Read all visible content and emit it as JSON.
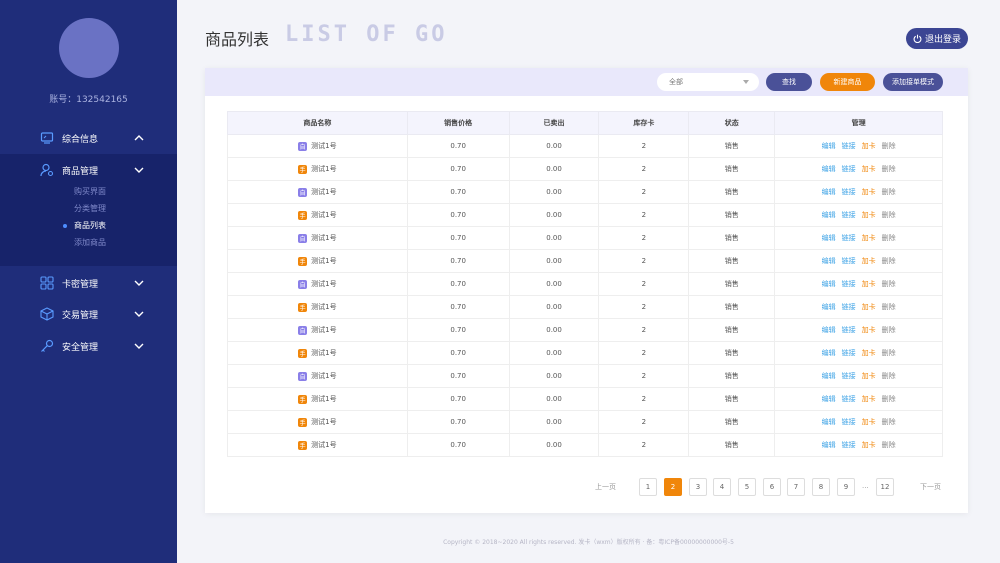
{
  "sidebar": {
    "account": "账号：132542165",
    "nav": [
      {
        "label": "综合信息",
        "icon": "dashboard-icon",
        "chevron": "up"
      },
      {
        "label": "商品管理",
        "icon": "user-icon",
        "chevron": "down"
      },
      {
        "label": "卡密管理",
        "icon": "grid-icon",
        "chevron": "down"
      },
      {
        "label": "交易管理",
        "icon": "box-icon",
        "chevron": "down"
      },
      {
        "label": "安全管理",
        "icon": "key-icon",
        "chevron": "down"
      }
    ],
    "sub": [
      "购买界面",
      "分类管理",
      "商品列表",
      "添加商品"
    ],
    "active_sub": "商品列表"
  },
  "header": {
    "title": "商品列表",
    "title_en": "LIST OF GO",
    "logout": "退出登录"
  },
  "toolbar": {
    "select_value": "全部",
    "search": "查找",
    "new": "新建商品",
    "batch": "添加接单模式"
  },
  "table": {
    "columns": [
      "商品名称",
      "销售价格",
      "已卖出",
      "库存卡",
      "状态",
      "管理"
    ],
    "actions": [
      "编辑",
      "链接",
      "加卡",
      "删除"
    ],
    "rows": [
      {
        "badge": "自",
        "type": "auto",
        "name": "测试1号",
        "price": "0.70",
        "sold": "0.00",
        "stock": "2",
        "status": "销售"
      },
      {
        "badge": "手",
        "type": "manual",
        "name": "测试1号",
        "price": "0.70",
        "sold": "0.00",
        "stock": "2",
        "status": "销售"
      },
      {
        "badge": "自",
        "type": "auto",
        "name": "测试1号",
        "price": "0.70",
        "sold": "0.00",
        "stock": "2",
        "status": "销售"
      },
      {
        "badge": "手",
        "type": "manual",
        "name": "测试1号",
        "price": "0.70",
        "sold": "0.00",
        "stock": "2",
        "status": "销售"
      },
      {
        "badge": "自",
        "type": "auto",
        "name": "测试1号",
        "price": "0.70",
        "sold": "0.00",
        "stock": "2",
        "status": "销售"
      },
      {
        "badge": "手",
        "type": "manual",
        "name": "测试1号",
        "price": "0.70",
        "sold": "0.00",
        "stock": "2",
        "status": "销售"
      },
      {
        "badge": "自",
        "type": "auto",
        "name": "测试1号",
        "price": "0.70",
        "sold": "0.00",
        "stock": "2",
        "status": "销售"
      },
      {
        "badge": "手",
        "type": "manual",
        "name": "测试1号",
        "price": "0.70",
        "sold": "0.00",
        "stock": "2",
        "status": "销售"
      },
      {
        "badge": "自",
        "type": "auto",
        "name": "测试1号",
        "price": "0.70",
        "sold": "0.00",
        "stock": "2",
        "status": "销售"
      },
      {
        "badge": "手",
        "type": "manual",
        "name": "测试1号",
        "price": "0.70",
        "sold": "0.00",
        "stock": "2",
        "status": "销售"
      },
      {
        "badge": "自",
        "type": "auto",
        "name": "测试1号",
        "price": "0.70",
        "sold": "0.00",
        "stock": "2",
        "status": "销售"
      },
      {
        "badge": "手",
        "type": "manual",
        "name": "测试1号",
        "price": "0.70",
        "sold": "0.00",
        "stock": "2",
        "status": "销售"
      },
      {
        "badge": "手",
        "type": "manual",
        "name": "测试1号",
        "price": "0.70",
        "sold": "0.00",
        "stock": "2",
        "status": "销售"
      },
      {
        "badge": "手",
        "type": "manual",
        "name": "测试1号",
        "price": "0.70",
        "sold": "0.00",
        "stock": "2",
        "status": "销售"
      }
    ]
  },
  "pagination": {
    "prev": "上一页",
    "next": "下一页",
    "pages": [
      "1",
      "2",
      "3",
      "4",
      "5",
      "6",
      "7",
      "8",
      "9"
    ],
    "ellipsis": "...",
    "last": "12",
    "current": "2"
  },
  "footer": "Copyright © 2018~2020 All rights reserved. 发卡（wxm）版权所有 · 备：粤ICP备00000000000号-5",
  "colors": {
    "sidebar": "#1f2d7a",
    "accent": "#f0860a",
    "primary": "#4a5198"
  }
}
